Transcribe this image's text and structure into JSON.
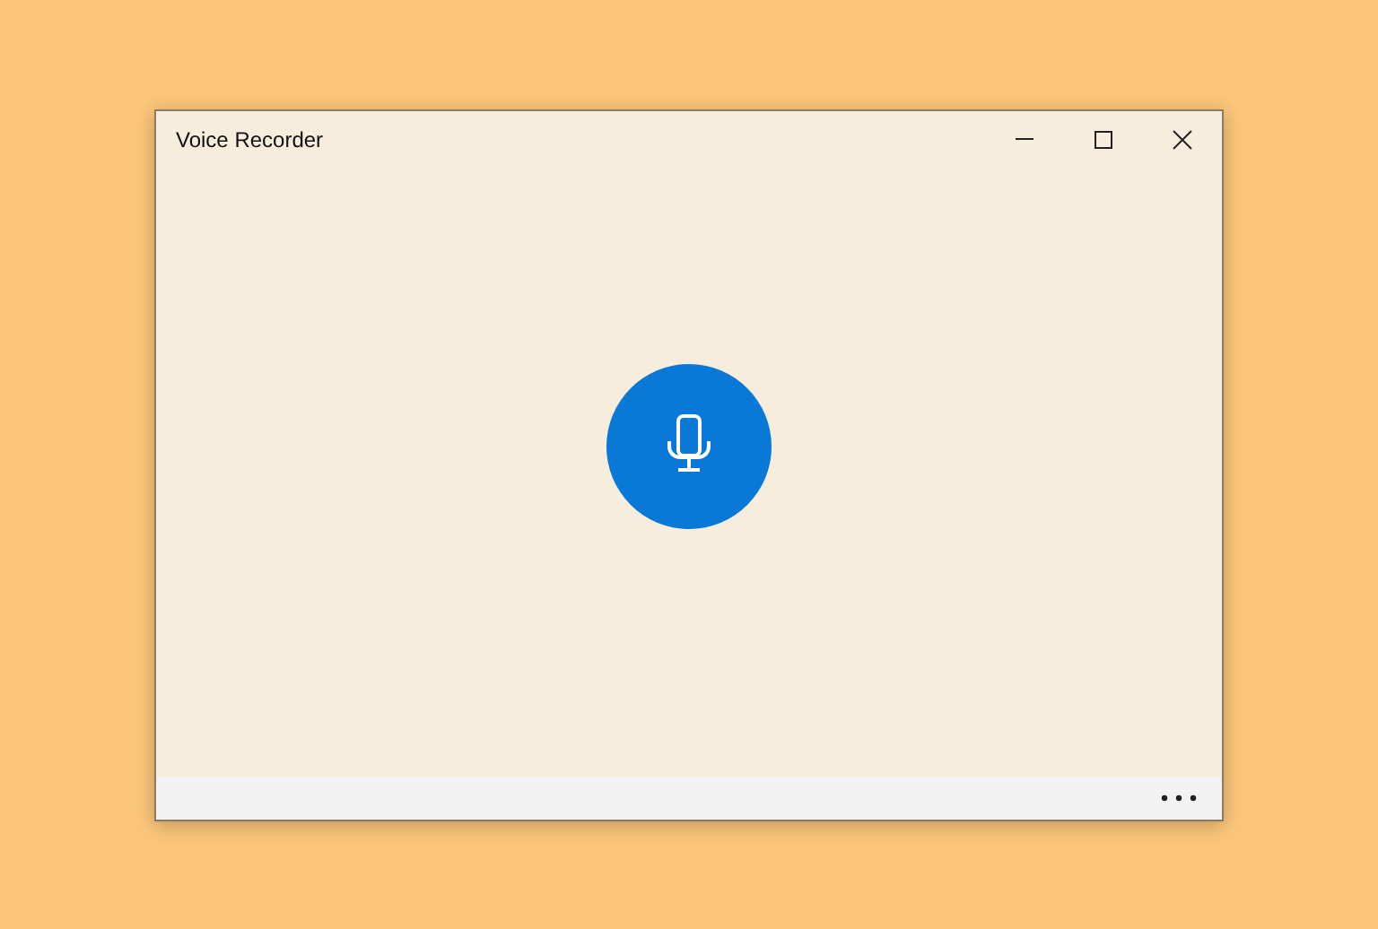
{
  "window": {
    "title": "Voice Recorder"
  }
}
